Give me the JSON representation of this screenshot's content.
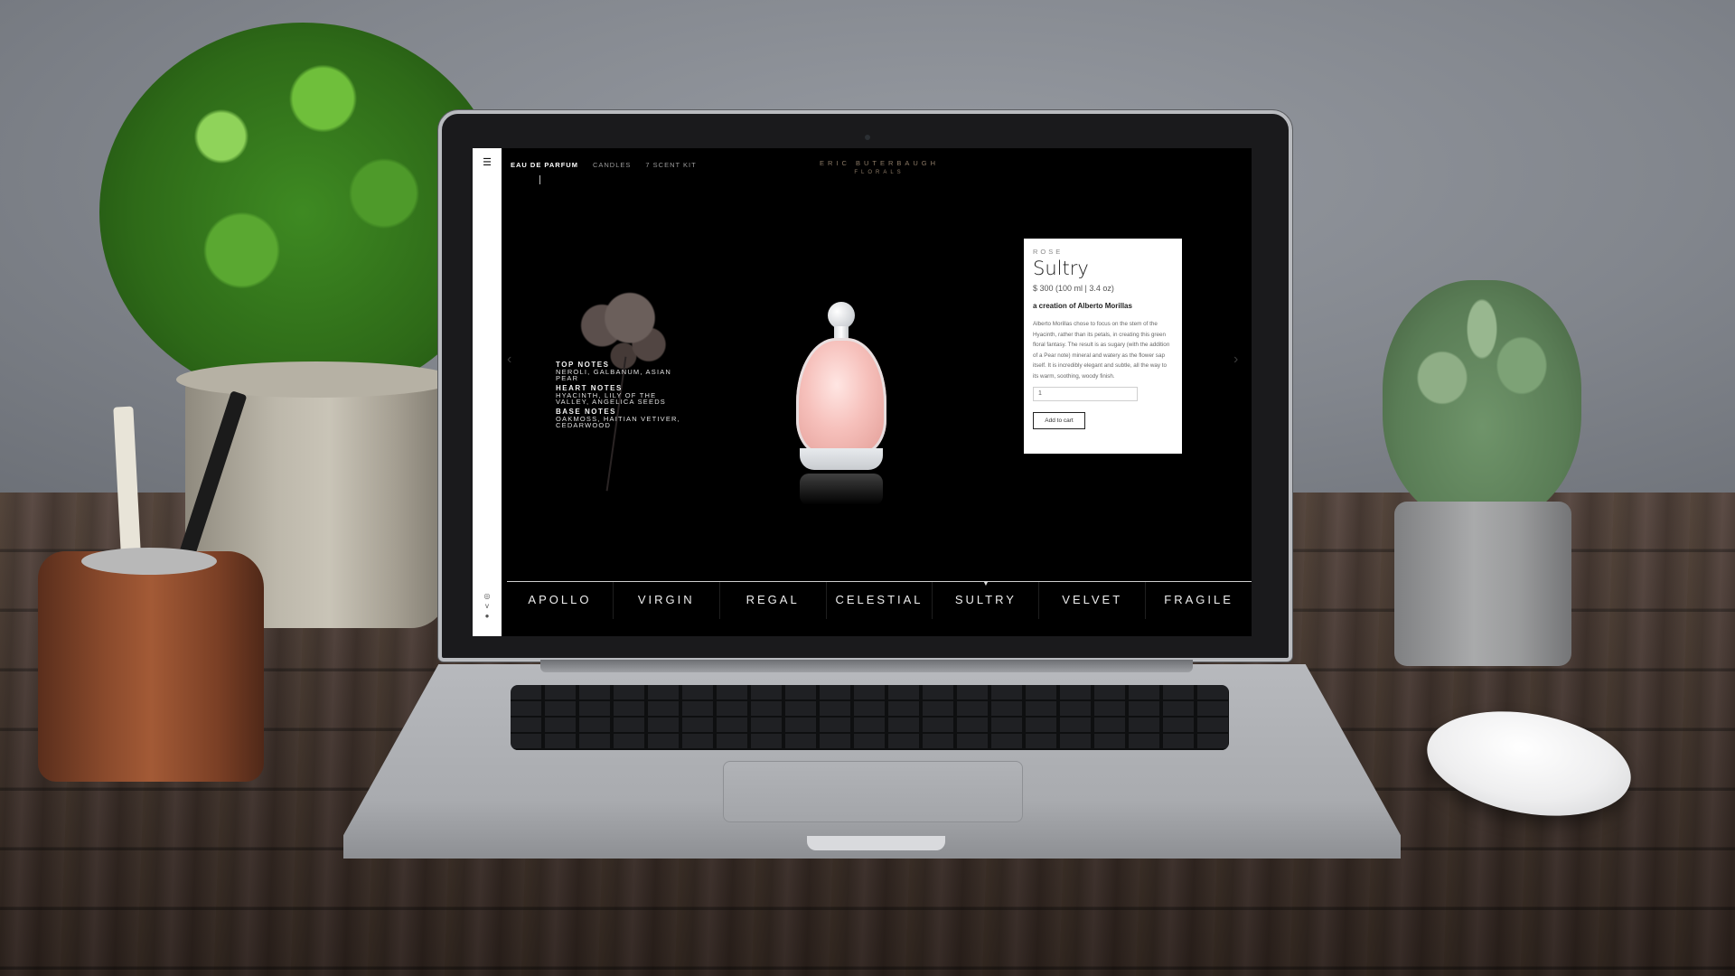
{
  "site": {
    "brand_line1": "ERIC BUTERBAUGH",
    "brand_line2": "FLORALS"
  },
  "sidebar": {
    "menu_icon": "☰",
    "icons": [
      "ig-icon",
      "twitter-icon",
      "pinterest-icon"
    ]
  },
  "topnav": {
    "items": [
      {
        "label": "EAU DE PARFUM",
        "active": true
      },
      {
        "label": "CANDLES",
        "active": false
      },
      {
        "label": "7 SCENT KIT",
        "active": false
      }
    ]
  },
  "notes": {
    "top_title": "TOP NOTES",
    "top_value": "NEROLI, GALBANUM, ASIAN PEAR",
    "heart_title": "HEART NOTES",
    "heart_value": "HYACINTH, LILY OF THE VALLEY, ANGELICA SEEDS",
    "base_title": "BASE NOTES",
    "base_value": "OAKMOSS, HAITIAN VETIVER, CEDARWOOD"
  },
  "product": {
    "category": "ROSE",
    "name": "Sultry",
    "price": "$ 300  (100 ml | 3.4 oz)",
    "creator": "a creation of Alberto Morillas",
    "description": "Alberto Morillas chose to focus on the stem of the Hyacinth, rather than its petals, in creating this green floral fantasy. The result is as sugary (with the addition of a Pear note) mineral and watery as the flower sap itself. It is incredibly elegant and subtle, all the way to its warm, soothing, woody finish.",
    "quantity": "1",
    "add_to_cart": "Add to cart"
  },
  "collection": {
    "items": [
      "APOLLO",
      "VIRGIN",
      "REGAL",
      "CELESTIAL",
      "SULTRY",
      "VELVET",
      "FRAGILE"
    ],
    "selected": "SULTRY"
  }
}
